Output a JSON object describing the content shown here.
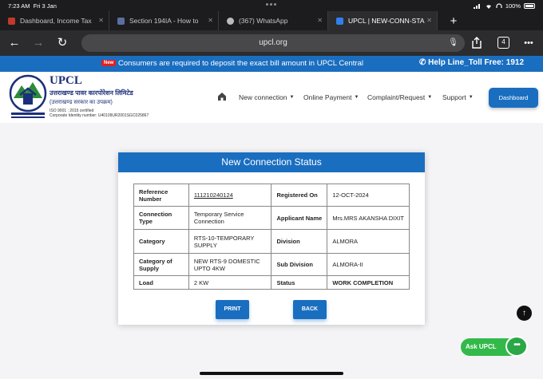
{
  "status_bar": {
    "time": "7:23 AM",
    "date": "Fri 3 Jan",
    "battery": "100%"
  },
  "browser": {
    "tabs": [
      {
        "title": "Dashboard, Income Tax",
        "favicon_color": "#c0392b"
      },
      {
        "title": "Section 194IA - How to",
        "favicon_color": "#5a6f9e"
      },
      {
        "title": "(367) WhatsApp",
        "favicon_color": "#bbbbbb"
      },
      {
        "title": "UPCL | NEW-CONN-STA",
        "favicon_color": "#2f80ed"
      }
    ],
    "active_tab_index": 3,
    "new_tab_label": "+",
    "url": "upcl.org",
    "tab_count": "4"
  },
  "site": {
    "ticker": {
      "badge": "New",
      "message": "Consumers are required to deposit the exact bill amount in UPCL Central",
      "helpline": "Help Line_Toll Free: 1912"
    },
    "logo": {
      "title": "UPCL",
      "hindi_name": "उत्तराखण्ड पावर कारपोरेशन लिमिटेड",
      "hindi_sub": "(उत्तराखण्ड सरकार का उपक्रम)",
      "iso": "ISO 9001 : 2015 certified",
      "cin": "Corporate Identity number: U40109UR2001SGC025867"
    },
    "nav": [
      {
        "label": "New connection"
      },
      {
        "label": "Online Payment"
      },
      {
        "label": "Complaint/Request"
      },
      {
        "label": "Support"
      }
    ],
    "dashboard_button": "Dashboard"
  },
  "status_card": {
    "title": "New Connection Status",
    "rows": [
      {
        "l1": "Reference Number",
        "v1": "111210240124",
        "l2": "Registered On",
        "v2": "12-OCT-2024"
      },
      {
        "l1": "Connection Type",
        "v1": "Temporary Service Connection",
        "l2": "Applicant Name",
        "v2": "Mrs.MRS AKANSHA DIXIT"
      },
      {
        "l1": "Category",
        "v1": "RTS-10-TEMPORARY SUPPLY",
        "l2": "Division",
        "v2": "ALMORA"
      },
      {
        "l1": "Category of Supply",
        "v1": "NEW RTS-9 DOMESTIC UPTO 4KW",
        "l2": "Sub Division",
        "v2": "ALMORA-II"
      },
      {
        "l1": "Load",
        "v1": "2 KW",
        "l2": "Status",
        "v2": "WORK COMPLETION"
      }
    ],
    "print_button": "PRINT",
    "back_button": "BACK"
  },
  "chat_widget": {
    "label": "Ask UPCL",
    "dots": "•••"
  },
  "colors": {
    "brand_blue": "#1a6ec0",
    "chat_green": "#32b94a",
    "ticker_badge": "#e02020"
  }
}
